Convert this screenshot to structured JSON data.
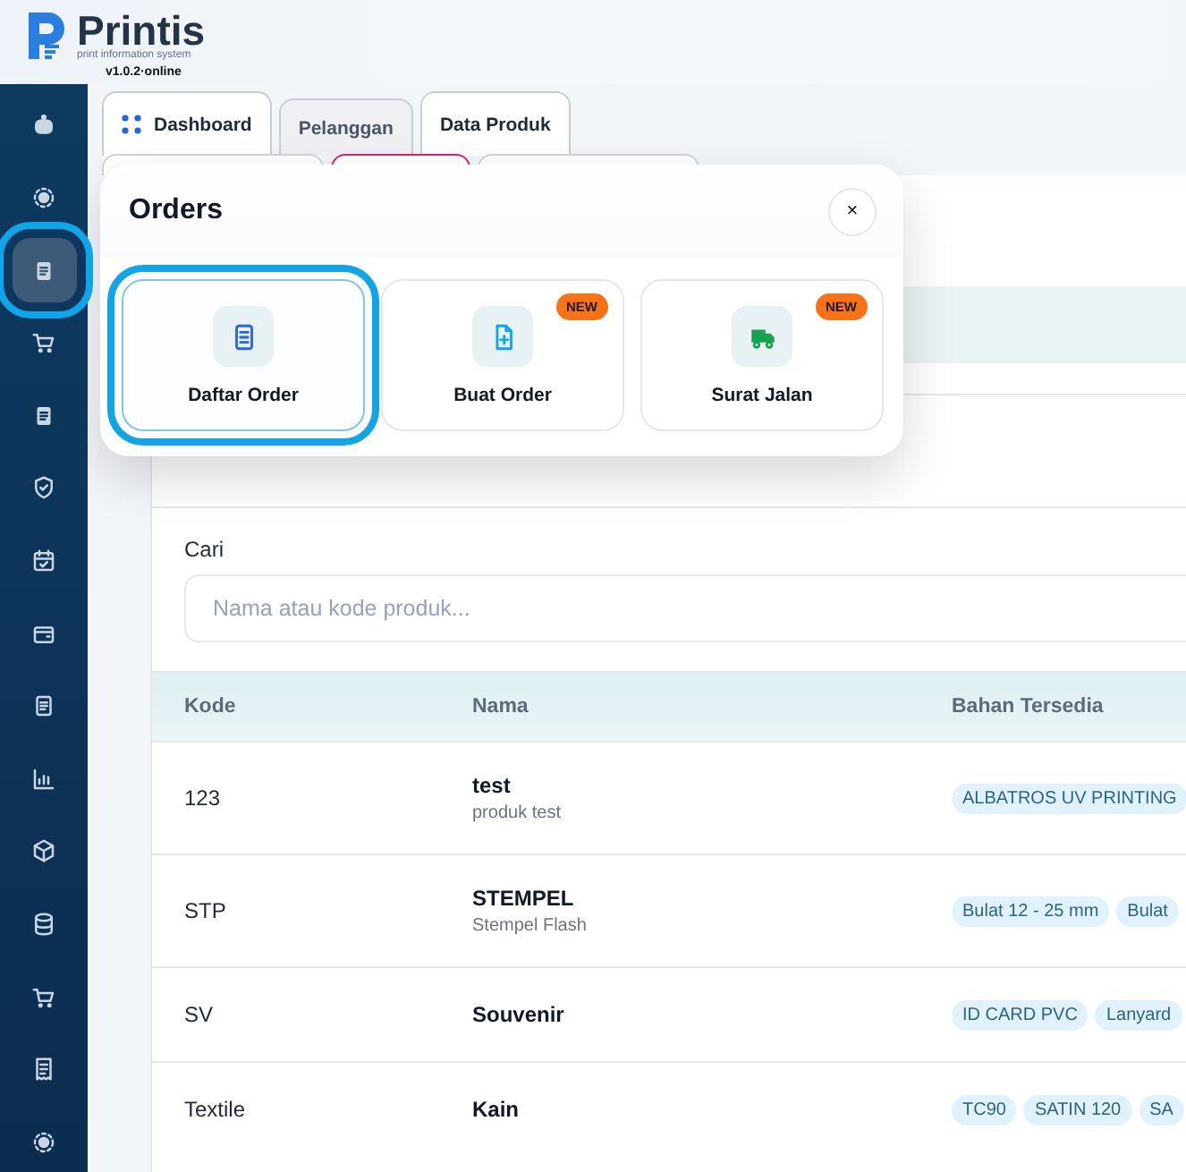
{
  "header": {
    "app_name": "Printis",
    "tagline": "print information system",
    "version": "v1.0.2·online"
  },
  "sidebar": {
    "items": [
      {
        "selected": false
      },
      {
        "selected": false
      },
      {
        "selected": true
      },
      {
        "selected": false
      },
      {
        "selected": false
      },
      {
        "selected": false
      },
      {
        "selected": false
      },
      {
        "selected": false
      },
      {
        "selected": false
      },
      {
        "selected": false
      },
      {
        "selected": false
      },
      {
        "selected": false
      },
      {
        "selected": false
      },
      {
        "selected": false
      },
      {
        "selected": false
      }
    ]
  },
  "tabs": [
    {
      "label": "Dashboard",
      "kind": "home",
      "dimmed": false
    },
    {
      "label": "Pelanggan",
      "kind": "page",
      "dimmed": true
    },
    {
      "label": "Data Produk",
      "kind": "page",
      "dimmed": false
    }
  ],
  "tab_stubs": [
    {
      "highlighted": false
    },
    {
      "highlighted": true
    },
    {
      "highlighted": false
    }
  ],
  "modal": {
    "title": "Orders",
    "close": "×",
    "items": [
      {
        "label": "Daftar Order",
        "kind": "list",
        "selected": true
      },
      {
        "label": "Buat Order",
        "kind": "create",
        "badge": "NEW",
        "selected": false
      },
      {
        "label": "Surat Jalan",
        "kind": "delivery",
        "badge": "NEW",
        "selected": false
      }
    ]
  },
  "search": {
    "label": "Cari",
    "placeholder": "Nama atau kode produk..."
  },
  "table": {
    "columns": [
      "Kode",
      "Nama",
      "Bahan Tersedia"
    ],
    "rows": [
      {
        "code": "123",
        "name": "test",
        "description": "produk test",
        "materials": [
          "ALBATROS UV PRINTING"
        ]
      },
      {
        "code": "STP",
        "name": "STEMPEL",
        "description": "Stempel Flash",
        "materials": [
          "Bulat 12 - 25 mm",
          "Bulat"
        ]
      },
      {
        "code": "SV",
        "name": "Souvenir",
        "materials": [
          "ID CARD PVC",
          "Lanyard"
        ]
      },
      {
        "code": "Textile",
        "name": "Kain",
        "materials": [
          "TC90",
          "SATIN 120",
          "SA"
        ]
      }
    ]
  }
}
